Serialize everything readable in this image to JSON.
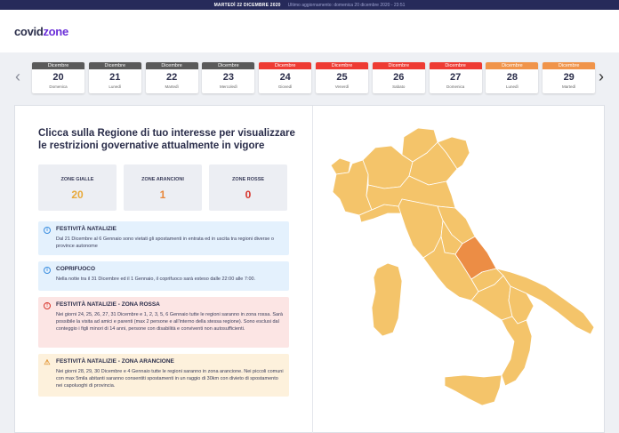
{
  "topbar": {
    "date": "MARTEDÌ 22 DICEMBRE 2020",
    "updated": "Ultimo aggiornamento: domenica 20 dicembre 2020 - 23:51"
  },
  "logo": {
    "part1": "covid",
    "part2": "zone"
  },
  "colors": {
    "dark": "#5a5a5a",
    "red": "#ee3b33",
    "orange": "#f0944a",
    "yellow_region": "#f4c46a",
    "orange_region": "#ec8d45"
  },
  "datebar": {
    "left_arrow": "‹",
    "right_arrow": "›",
    "days": [
      {
        "month": "Dicembre",
        "num": "20",
        "weekday": "Domenica"
      },
      {
        "month": "Dicembre",
        "num": "21",
        "weekday": "Lunedì"
      },
      {
        "month": "Dicembre",
        "num": "22",
        "weekday": "Martedì"
      },
      {
        "month": "Dicembre",
        "num": "23",
        "weekday": "Mercoledì"
      },
      {
        "month": "Dicembre",
        "num": "24",
        "weekday": "Giovedì"
      },
      {
        "month": "Dicembre",
        "num": "25",
        "weekday": "Venerdì"
      },
      {
        "month": "Dicembre",
        "num": "26",
        "weekday": "Sabato"
      },
      {
        "month": "Dicembre",
        "num": "27",
        "weekday": "Domenica"
      },
      {
        "month": "Dicembre",
        "num": "28",
        "weekday": "Lunedì"
      },
      {
        "month": "Dicembre",
        "num": "29",
        "weekday": "Martedì"
      }
    ]
  },
  "main": {
    "headline": "Clicca sulla Regione di tuo interesse per visualizzare le restrizioni governative attualmente in vigore",
    "zones": [
      {
        "label": "ZONE GIALLE",
        "value": "20",
        "color": "#e8a93a"
      },
      {
        "label": "ZONE ARANCIONI",
        "value": "1",
        "color": "#e8873a"
      },
      {
        "label": "ZONE ROSSE",
        "value": "0",
        "color": "#d8362d"
      }
    ],
    "notices": [
      {
        "icon": "i",
        "title": "FESTIVITÀ NATALIZIE",
        "body": "Dal 21 Dicembre al 6 Gennaio sono vietati gli spostamenti in entrata ed in uscita tra regioni diverse o province autonome"
      },
      {
        "icon": "i",
        "title": "COPRIFUOCO",
        "body": "Nella notte tra il 31 Dicembre ed il 1 Gennaio, il coprifuoco sarà esteso dalle 22:00 alle 7:00."
      },
      {
        "icon": "!",
        "title": "FESTIVITÀ NATALIZIE - ZONA ROSSA",
        "body": "Nei giorni 24, 25, 26, 27, 31 Dicembre e 1, 2, 3, 5, 6 Gennaio tutte le regioni saranno in zona rossa. Sarà possibile la visita ad amici e parenti (max 2 persone e all'interno della stessa regione). Sono esclusi dal conteggio i figli minori di 14 anni, persone con disabilità e conviventi non autosufficienti."
      },
      {
        "icon": "⚠",
        "title": "FESTIVITÀ NATALIZIE - ZONA ARANCIONE",
        "body": "Nei giorni 28, 29, 30 Dicembre e 4 Gennaio tutte le regioni saranno in zona arancione. Nei piccoli comuni con max 5mila abitanti saranno consentiti spostamenti in un raggio di 30km con divieto di spostamento nei capoluoghi di provincia."
      }
    ]
  }
}
